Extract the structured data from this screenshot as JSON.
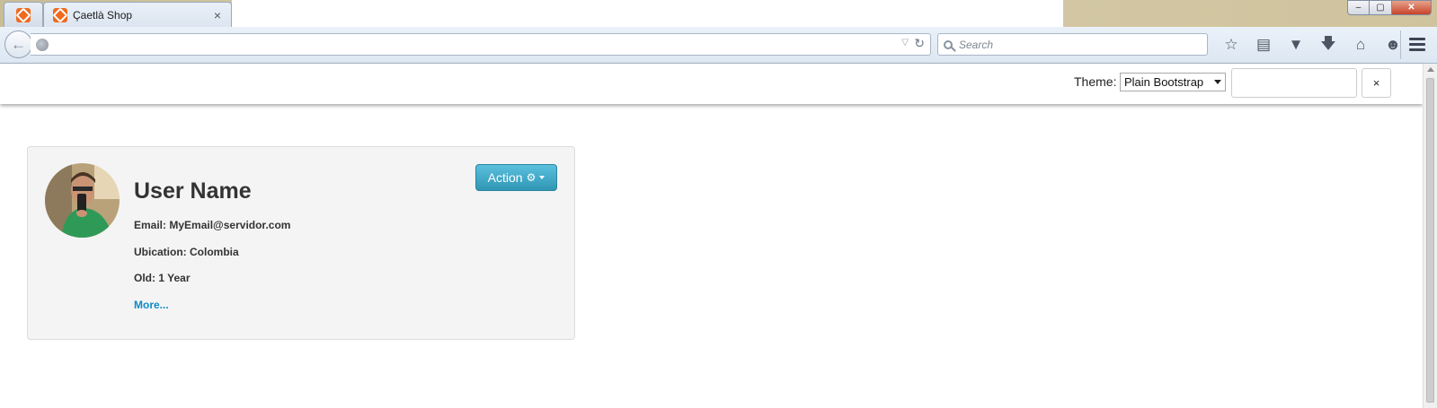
{
  "browser": {
    "tabs": [
      {
        "title": "Çaetlà Shop",
        "close_label": "×"
      }
    ],
    "window_controls": {
      "minimize": "–",
      "restore": "▢",
      "close": "✕"
    },
    "search_placeholder": "Search",
    "nav_icons": [
      "star-icon",
      "reading-list-icon",
      "pocket-icon",
      "download-icon",
      "home-icon",
      "chat-icon"
    ]
  },
  "theme_bar": {
    "label": "Theme:",
    "selected": "Plain Bootstrap",
    "close_label": "×"
  },
  "profile": {
    "name": "User Name",
    "email_label": "Email:",
    "email": "MyEmail@servidor.com",
    "location_label": "Ubication:",
    "location": "Colombia",
    "age_label": "Old:",
    "age": "1 Year",
    "more_link": "More...",
    "action_label": "Action"
  },
  "colors": {
    "action_button": "#31a0c4",
    "link": "#0e8ac8",
    "card_bg": "#f4f4f4"
  }
}
